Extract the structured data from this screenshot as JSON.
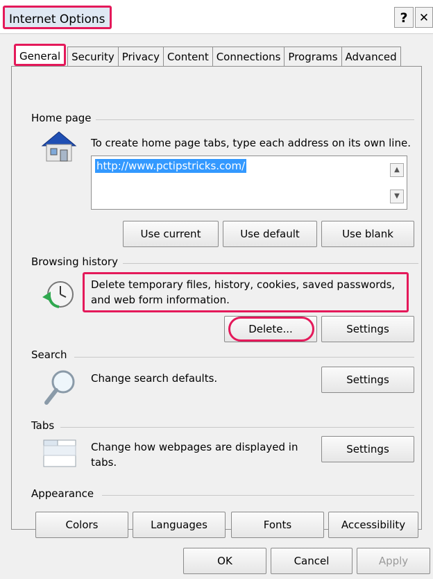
{
  "window": {
    "title": "Internet Options",
    "help_label": "?",
    "close_label": "✕"
  },
  "tabs": [
    {
      "label": "General",
      "active": true
    },
    {
      "label": "Security"
    },
    {
      "label": "Privacy"
    },
    {
      "label": "Content"
    },
    {
      "label": "Connections"
    },
    {
      "label": "Programs"
    },
    {
      "label": "Advanced"
    }
  ],
  "home_page": {
    "label": "Home page",
    "description": "To create home page tabs, type each address on its own line.",
    "url": "http://www.pctipstricks.com/",
    "use_current": "Use current",
    "use_default": "Use default",
    "use_blank": "Use blank",
    "icon": "home-icon"
  },
  "browsing_history": {
    "label": "Browsing history",
    "description_line1": "Delete temporary files, history, cookies, saved passwords,",
    "description_line2": "and web form information.",
    "delete_label": "Delete...",
    "settings_label": "Settings",
    "icon": "history-clock-icon"
  },
  "search": {
    "label": "Search",
    "description": "Change search defaults.",
    "settings_label": "Settings",
    "icon": "magnifier-icon"
  },
  "tabs_section": {
    "label": "Tabs",
    "description_line1": "Change how webpages are displayed in",
    "description_line2": "tabs.",
    "settings_label": "Settings",
    "icon": "tabs-window-icon"
  },
  "appearance": {
    "label": "Appearance",
    "colors": "Colors",
    "languages": "Languages",
    "fonts": "Fonts",
    "accessibility": "Accessibility"
  },
  "footer": {
    "ok": "OK",
    "cancel": "Cancel",
    "apply": "Apply"
  },
  "colors": {
    "highlight": "#e4195a",
    "selection": "#3399ff",
    "dialog_bg": "#f0f0f0"
  }
}
